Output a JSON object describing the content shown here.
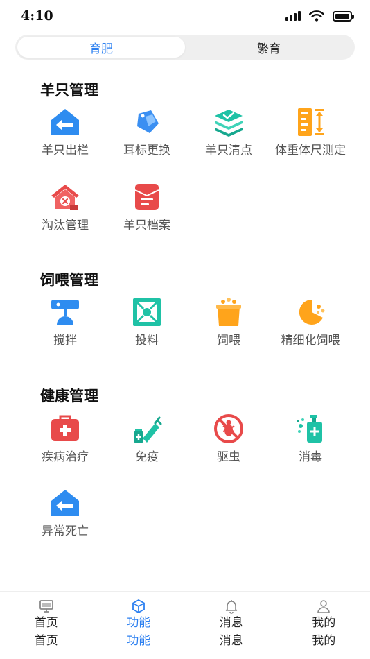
{
  "status": {
    "time": "4:10"
  },
  "tabs": [
    {
      "label": "育肥",
      "active": true
    },
    {
      "label": "繁育",
      "active": false
    }
  ],
  "sections": [
    {
      "title": "羊只管理",
      "items": [
        {
          "label": "羊只出栏",
          "icon": "house-exit-icon"
        },
        {
          "label": "耳标更换",
          "icon": "ear-tag-icon"
        },
        {
          "label": "羊只清点",
          "icon": "stack-check-icon"
        },
        {
          "label": "体重体尺测定",
          "icon": "measure-ruler-icon"
        },
        {
          "label": "淘汰管理",
          "icon": "house-remove-icon"
        },
        {
          "label": "羊只档案",
          "icon": "archive-folder-icon"
        }
      ]
    },
    {
      "title": "饲喂管理",
      "items": [
        {
          "label": "搅拌",
          "icon": "mixer-icon"
        },
        {
          "label": "投料",
          "icon": "feeding-box-icon"
        },
        {
          "label": "饲喂",
          "icon": "feed-bucket-icon"
        },
        {
          "label": "精细化饲喂",
          "icon": "precision-feed-icon"
        }
      ]
    },
    {
      "title": "健康管理",
      "items": [
        {
          "label": "疾病治疗",
          "icon": "medical-kit-icon"
        },
        {
          "label": "免疫",
          "icon": "syringe-icon"
        },
        {
          "label": "驱虫",
          "icon": "no-bug-icon"
        },
        {
          "label": "消毒",
          "icon": "disinfect-bottle-icon"
        },
        {
          "label": "异常死亡",
          "icon": "house-exit-icon"
        }
      ]
    }
  ],
  "nav": [
    {
      "label": "首页",
      "sublabel": "首页",
      "icon": "monitor-icon",
      "active": false
    },
    {
      "label": "功能",
      "sublabel": "功能",
      "icon": "cube-icon",
      "active": true
    },
    {
      "label": "消息",
      "sublabel": "消息",
      "icon": "bell-icon",
      "active": false
    },
    {
      "label": "我的",
      "sublabel": "我的",
      "icon": "person-icon",
      "active": false
    }
  ],
  "colors": {
    "accent": "#2b7ff0",
    "blue_icon": "#2e8cf0",
    "red_icon": "#e84a4a",
    "teal_icon": "#1fc2a6",
    "orange_icon": "#ffa41b"
  }
}
